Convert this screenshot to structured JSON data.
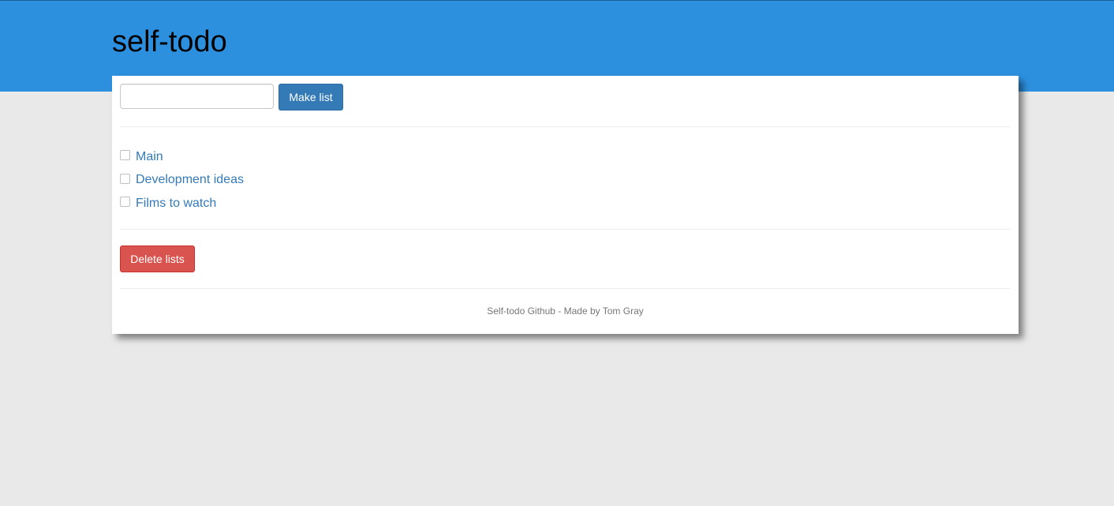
{
  "app": {
    "title": "self-todo"
  },
  "form": {
    "input_value": "",
    "input_placeholder": "",
    "make_button_label": "Make list"
  },
  "lists": [
    {
      "label": "Main",
      "checked": false
    },
    {
      "label": "Development ideas",
      "checked": false
    },
    {
      "label": "Films to watch",
      "checked": false
    }
  ],
  "actions": {
    "delete_button_label": "Delete lists"
  },
  "footer": {
    "text": "Self-todo Github - Made by Tom Gray"
  },
  "colors": {
    "header": "#2d90df",
    "primary": "#337ab7",
    "danger": "#d9534f",
    "background": "#e9e9e9"
  }
}
